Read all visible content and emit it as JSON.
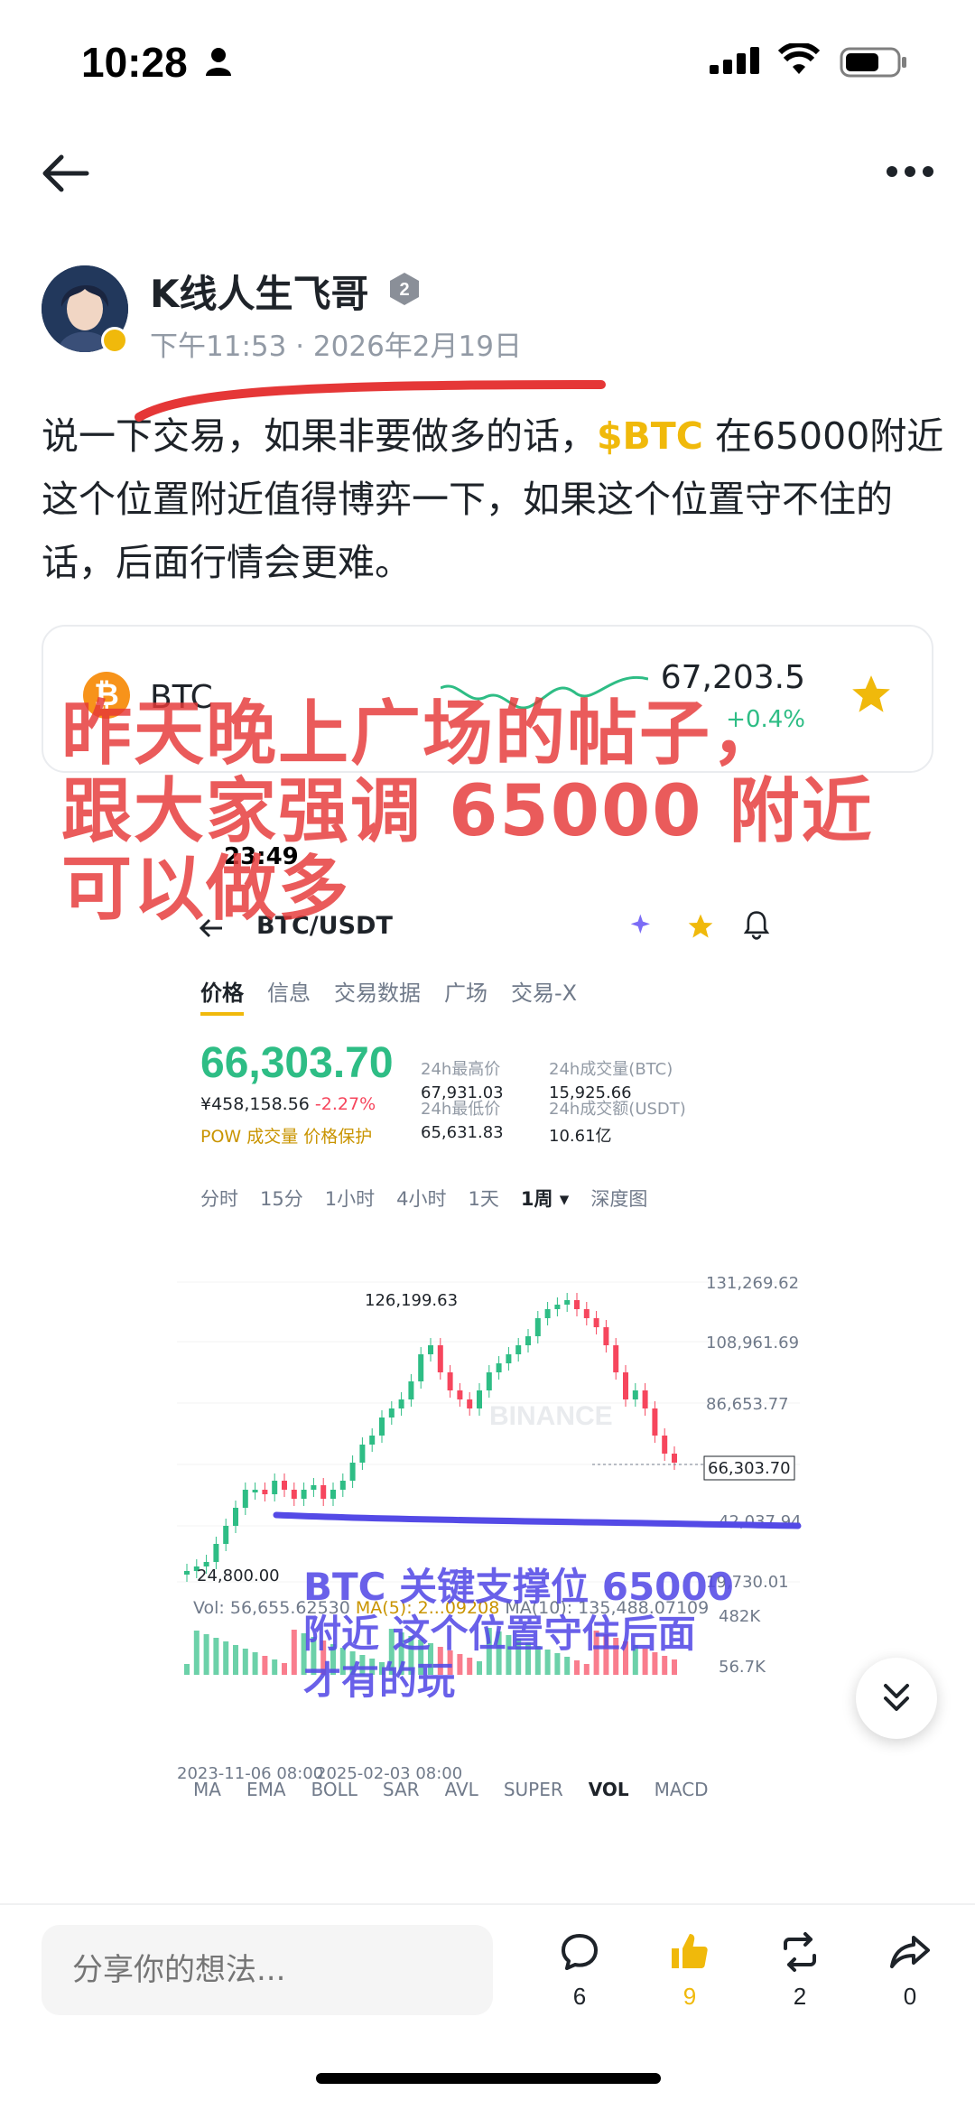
{
  "status_bar": {
    "time": "10:28"
  },
  "author": {
    "name": "K线人生飞哥",
    "level": "2",
    "timestamp": "下午11:53 · 2026年2月19日"
  },
  "post": {
    "text_before": "说一下交易，如果非要做多的话，",
    "ticker": "$BTC",
    "text_after": " 在65000附近这个位置附近值得博弈一下，如果这个位置守不住的话，后面行情会更难。"
  },
  "coin_card": {
    "symbol": "BTC",
    "price": "67,203.5",
    "change": "+0.4%"
  },
  "overlay": {
    "red_line1": "昨天晚上广场的帖子，",
    "red_line2": "跟大家强调 65000 附近",
    "red_line3": "可以做多",
    "blue_line1": "BTC 关键支撑位 65000",
    "blue_line2": "附近 这个位置守住后面",
    "blue_line3": "才有的玩"
  },
  "inner_app": {
    "time": "23:49",
    "pair": "BTC/USDT",
    "tabs": [
      "价格",
      "信息",
      "交易数据",
      "广场",
      "交易-X"
    ],
    "price": "66,303.70",
    "cny": "¥458,158.56",
    "change": "-2.27%",
    "pow": "POW  成交量  价格保护",
    "stats": {
      "high_label": "24h最高价",
      "high": "67,931.03",
      "low_label": "24h最低价",
      "low": "65,631.83",
      "vol_btc_label": "24h成交量(BTC)",
      "vol_btc": "15,925.66",
      "vol_usdt_label": "24h成交额(USDT)",
      "vol_usdt": "10.61亿"
    },
    "intervals": [
      "分时",
      "15分",
      "1小时",
      "4小时",
      "1天",
      "1周 ▾",
      "深度图"
    ],
    "axis_labels": [
      "131,269.62",
      "108,961.69",
      "86,653.77",
      "66,303.70",
      "42,037.94",
      "19,730.01"
    ],
    "peak_label": "126,199.63",
    "low_label": "24,800.00",
    "watermark": "BINANCE",
    "vol_prefix": "Vol: 56,655.62530",
    "vol_ma5": "MA(5): 2...09208",
    "vol_ma10": "MA(10): 135,488.07109",
    "vol_axis": [
      "482K",
      "56.7K"
    ],
    "dates": [
      "2023-11-06 08:00",
      "2025-02-03 08:00"
    ],
    "indicators": [
      "MA",
      "EMA",
      "BOLL",
      "SAR",
      "AVL",
      "SUPER",
      "VOL",
      "MACD"
    ]
  },
  "bottom_bar": {
    "placeholder": "分享你的想法...",
    "comments": "6",
    "likes": "9",
    "reposts": "2",
    "shares": "0"
  },
  "colors": {
    "brand_yellow": "#f0b90b",
    "up_green": "#2ebd85",
    "down_red": "#f6465d",
    "annotation_red": "#e53737",
    "annotation_blue": "#544ae6"
  }
}
